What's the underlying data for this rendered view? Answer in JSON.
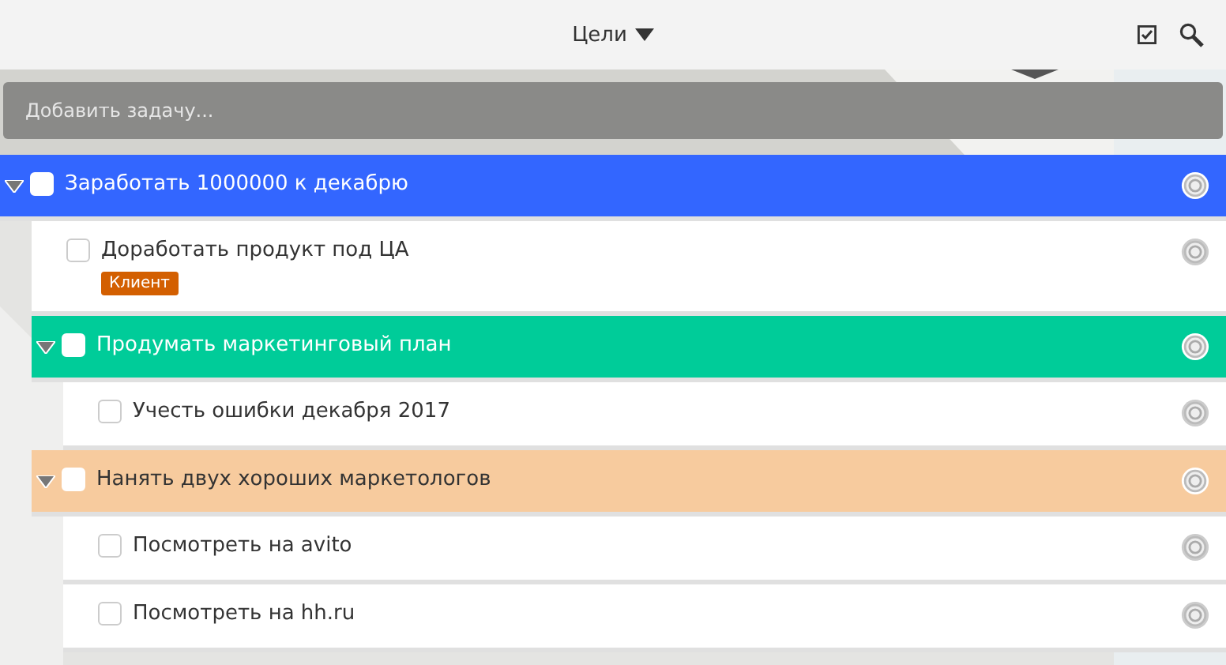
{
  "header": {
    "title": "Цели"
  },
  "add_task": {
    "placeholder": "Добавить задачу..."
  },
  "tasks": [
    {
      "title": "Заработать 1000000 к декабрю",
      "checked": false,
      "expanded": true,
      "color": "#3366ff",
      "children": [
        {
          "title": "Доработать продукт под ЦА",
          "checked": false,
          "tags": [
            {
              "label": "Клиент",
              "color": "#d35f00"
            }
          ]
        },
        {
          "title": "Продумать маркетинговый план",
          "checked": false,
          "expanded": true,
          "color": "#00cc99",
          "children": [
            {
              "title": "Учесть ошибки декабря 2017",
              "checked": false
            }
          ]
        },
        {
          "title": "Нанять двух хороших маркетологов",
          "checked": false,
          "expanded": true,
          "color": "#f7cb9e",
          "children": [
            {
              "title": "Посмотреть на avito",
              "checked": false
            },
            {
              "title": "Посмотреть на hh.ru",
              "checked": false
            }
          ]
        }
      ]
    }
  ]
}
